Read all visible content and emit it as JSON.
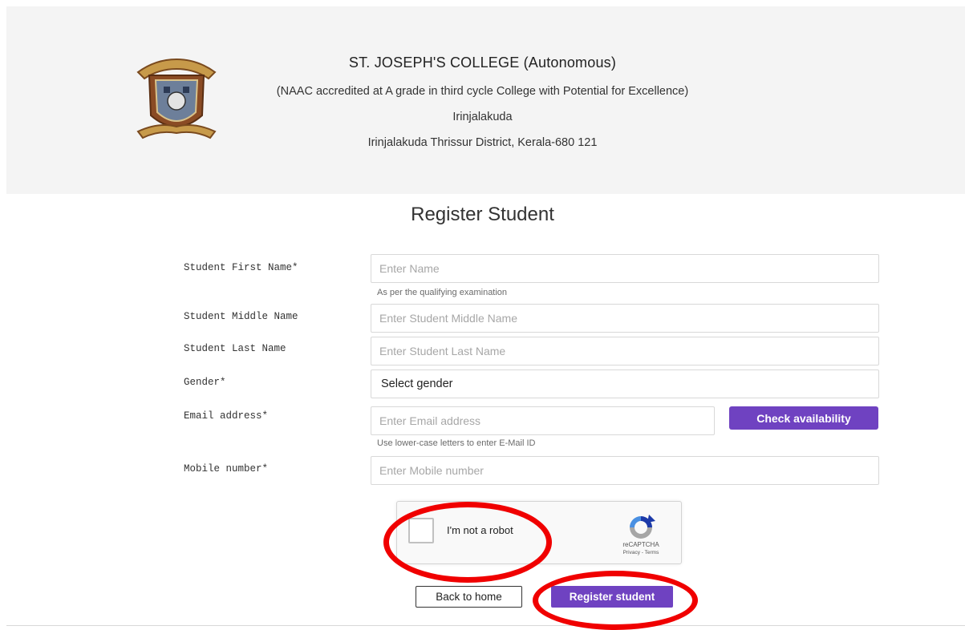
{
  "header": {
    "college_name": "ST. JOSEPH'S COLLEGE (Autonomous)",
    "accreditation": "(NAAC accredited at A grade in third cycle College with Potential for Excellence)",
    "city": "Irinjalakuda",
    "address": "Irinjalakuda Thrissur District, Kerala-680 121",
    "logo_icon": "college-crest-icon"
  },
  "page_title": "Register Student",
  "form": {
    "first_name": {
      "label": "Student First Name*",
      "placeholder": "Enter Name",
      "value": "",
      "help": "As per the qualifying examination"
    },
    "middle_name": {
      "label": "Student Middle Name",
      "placeholder": "Enter Student Middle Name",
      "value": ""
    },
    "last_name": {
      "label": "Student Last Name",
      "placeholder": "Enter Student Last Name",
      "value": ""
    },
    "gender": {
      "label": "Gender*",
      "selected": "Select gender"
    },
    "email": {
      "label": "Email address*",
      "placeholder": "Enter Email address",
      "value": "",
      "help": "Use lower-case letters to enter E-Mail ID",
      "check_button": "Check availability"
    },
    "mobile": {
      "label": "Mobile number*",
      "placeholder": "Enter Mobile number",
      "value": ""
    }
  },
  "captcha": {
    "label": "I'm not a robot",
    "brand": "reCAPTCHA",
    "links": "Privacy - Terms",
    "icon": "recaptcha-logo-icon"
  },
  "actions": {
    "back": "Back to home",
    "register": "Register student"
  },
  "colors": {
    "primary": "#6f42c1",
    "header_bg": "#f4f4f4",
    "highlight": "#f00000"
  }
}
